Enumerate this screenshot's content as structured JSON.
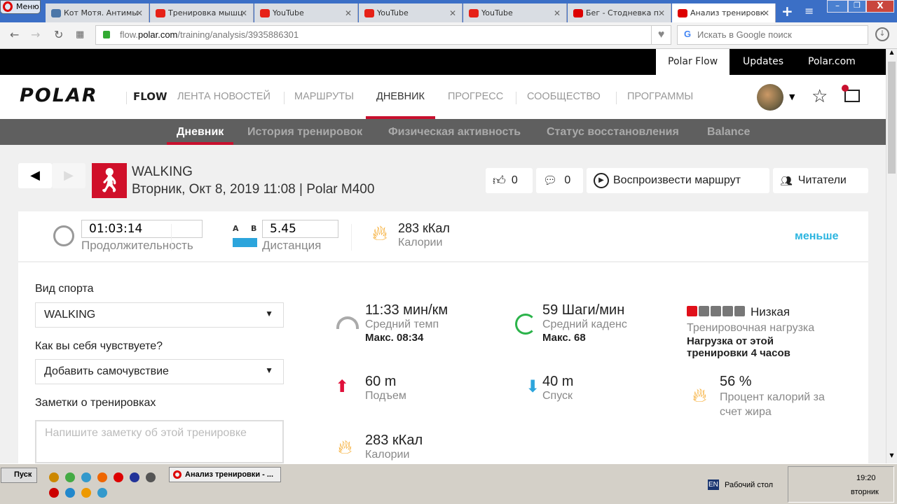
{
  "browser": {
    "menu": "Меню",
    "tabs": [
      {
        "label": "Кот Мотя. Антимы",
        "color": "#4a76a8"
      },
      {
        "label": "Тренировка мышц",
        "color": "#e62117"
      },
      {
        "label": "YouTube",
        "color": "#e62117"
      },
      {
        "label": "YouTube",
        "color": "#e62117"
      },
      {
        "label": "YouTube",
        "color": "#e62117"
      },
      {
        "label": "Бег - Стодневка п",
        "color": "#d00"
      },
      {
        "label": "Анализ тренировк",
        "color": "#d00"
      }
    ],
    "url_host": "flow.",
    "url_domain": "polar.com",
    "url_path": "/training/analysis/3935886301",
    "search_placeholder": "Искать в Google поиск"
  },
  "topbar": {
    "links": [
      "Polar Flow",
      "Updates",
      "Polar.com"
    ]
  },
  "nav": {
    "logo": "POLAR",
    "flow": "FLOW",
    "items": [
      "ЛЕНТА НОВОСТЕЙ",
      "МАРШРУТЫ",
      "ДНЕВНИК",
      "ПРОГРЕСС",
      "СООБЩЕСТВО",
      "ПРОГРАММЫ"
    ]
  },
  "subnav": {
    "items": [
      "Дневник",
      "История тренировок",
      "Физическая активность",
      "Статус восстановления",
      "Balance"
    ]
  },
  "session": {
    "sport": "WALKING",
    "subtitle": "Вторник, Окт 8, 2019 11:08 | Polar M400",
    "likes": "0",
    "comments": "0",
    "replay": "Воспроизвести маршрут",
    "followers": "Читатели"
  },
  "summary": {
    "duration": "01:03:14",
    "duration_label": "Продолжительность",
    "ab_a": "A",
    "ab_b": "B",
    "distance": "5.45",
    "distance_label": "Дистанция",
    "calories": "283 кКал",
    "calories_label": "Калории",
    "less": "меньше"
  },
  "form": {
    "sport_label": "Вид спорта",
    "sport_value": "WALKING",
    "feeling_label": "Как вы себя чувствуете?",
    "feeling_value": "Добавить самочувствие",
    "notes_label": "Заметки о тренировках",
    "notes_placeholder": "Напишите заметку об этой тренировке"
  },
  "stats": {
    "pace": {
      "value": "11:33 мин/км",
      "label": "Средний темп",
      "max": "Макс. 08:34"
    },
    "cadence": {
      "value": "59 Шаги/мин",
      "label": "Средний каденс",
      "max": "Макс. 68"
    },
    "load": {
      "level": "Низкая",
      "level_fraction": 0.2,
      "label": "Тренировочная нагрузка",
      "desc": "Нагрузка от этой тренировки 4 часов"
    },
    "ascent": {
      "value": "60 m",
      "label": "Подъем"
    },
    "descent": {
      "value": "40 m",
      "label": "Спуск"
    },
    "fat": {
      "value": "56 %",
      "label": "Процент калорий за счет жира"
    },
    "calories": {
      "value": "283 кКал",
      "label": "Калории"
    }
  },
  "taskbar": {
    "start": "Пуск",
    "window": "Анализ тренировки - ...",
    "lang": "EN",
    "desktop": "Рабочий стол",
    "time": "19:20",
    "day": "вторник"
  }
}
